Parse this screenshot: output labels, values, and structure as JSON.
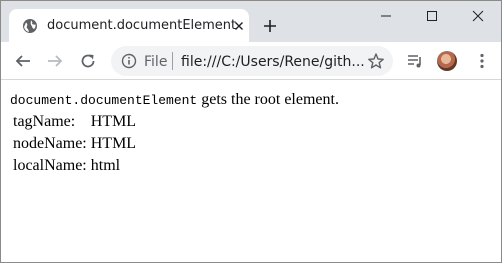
{
  "tab": {
    "title": "document.documentElement",
    "favicon": "globe-icon"
  },
  "toolbar": {
    "scheme": "File",
    "url": "file:///C:/Users/Rene/gith..."
  },
  "page": {
    "intro_code": "document.documentElement",
    "intro_text": " gets the root element.",
    "rows": [
      {
        "label": "tagName:",
        "value": "HTML"
      },
      {
        "label": "nodeName:",
        "value": "HTML"
      },
      {
        "label": "localName:",
        "value": "html"
      }
    ]
  },
  "colors": {
    "titlebar": "#dee1e6",
    "tab": "#ffffff",
    "omnibox": "#f1f3f4",
    "icon": "#5f6368"
  }
}
